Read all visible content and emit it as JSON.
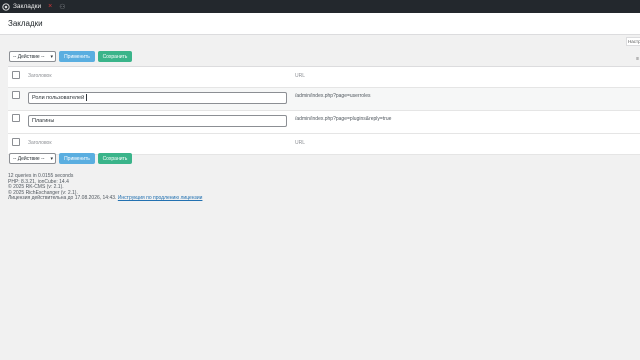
{
  "topbar": {
    "logo_icon": "app-logo-icon",
    "site_name": "Закладки",
    "close_glyph": "×",
    "extra_glyph": "⚇"
  },
  "page": {
    "title": "Закладки",
    "screen_options": "Настройки",
    "right_mark": "≡"
  },
  "bulk": {
    "select_value": "-- Действие --",
    "apply_label": "Применить",
    "save_label": "Сохранить"
  },
  "table": {
    "columns": {
      "title": "Заголовок",
      "url": "URL"
    },
    "rows": [
      {
        "title": "Роли пользователей",
        "url": "/admin/index.php?page=userroles"
      },
      {
        "title": "Плагины",
        "url": "/admin/index.php?page=plugins&reply=true"
      }
    ]
  },
  "footer": {
    "queries": "12 queries in 0.0155 seconds",
    "php": "PHP: 8.3.21, ionCube: 14.4",
    "cms": "© 2025 RK-CMS (v: 2.1).",
    "exchanger": "© 2025 RichExchanger (v: 2.1).",
    "license_prefix": "Лицензия действительна до 17.08.2026, 14:43.",
    "license_link": "Инструкция по продлению лицензии"
  },
  "colors": {
    "topbar": "#23282d",
    "apply": "#5aaee0",
    "save": "#3ab48a",
    "link": "#2271b1"
  }
}
